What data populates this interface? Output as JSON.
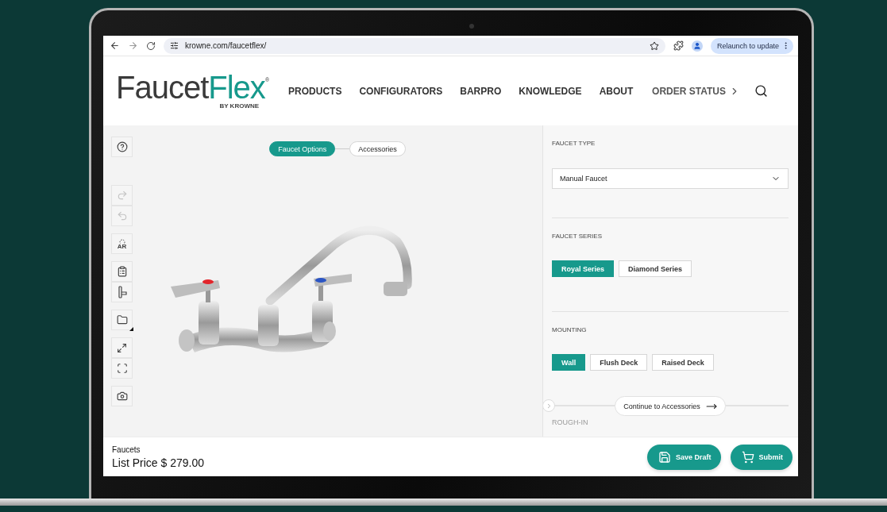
{
  "browser": {
    "url": "krowne.com/faucetflex/",
    "relaunch_label": "Relaunch to update"
  },
  "site": {
    "logo": {
      "main": "Faucet",
      "accent": "Flex",
      "mark": "®",
      "byline": "BY KROWNE"
    },
    "nav": [
      "PRODUCTS",
      "CONFIGURATORS",
      "BARPRO",
      "KNOWLEDGE",
      "ABOUT"
    ],
    "order_status": "ORDER STATUS"
  },
  "viewer": {
    "steps": [
      {
        "label": "Faucet Options",
        "selected": true
      },
      {
        "label": "Accessories",
        "selected": false
      }
    ],
    "tool_groups": [
      [
        {
          "kind": "help",
          "disabled": false
        }
      ],
      [
        {
          "kind": "redo",
          "disabled": true
        },
        {
          "kind": "undo",
          "disabled": true
        }
      ],
      [
        {
          "kind": "ar",
          "label": "AR",
          "disabled": false
        }
      ],
      [
        {
          "kind": "clipboard",
          "disabled": false
        },
        {
          "kind": "handle",
          "disabled": false
        }
      ],
      [
        {
          "kind": "folder",
          "disabled": false
        }
      ],
      [
        {
          "kind": "expand",
          "disabled": false
        },
        {
          "kind": "frame",
          "disabled": false
        }
      ],
      [
        {
          "kind": "camera",
          "disabled": false
        }
      ]
    ]
  },
  "panel": {
    "sections": [
      {
        "kind": "select",
        "title": "FAUCET TYPE",
        "value": "Manual Faucet"
      },
      {
        "kind": "options",
        "title": "FAUCET SERIES",
        "options": [
          {
            "label": "Royal Series",
            "selected": true
          },
          {
            "label": "Diamond Series",
            "selected": false
          }
        ]
      },
      {
        "kind": "options",
        "title": "MOUNTING",
        "options": [
          {
            "label": "Wall",
            "selected": true
          },
          {
            "label": "Flush Deck",
            "selected": false
          },
          {
            "label": "Raised Deck",
            "selected": false
          }
        ]
      }
    ],
    "continue_label": "Continue to Accessories",
    "next_title": "ROUGH-IN"
  },
  "footer": {
    "category": "Faucets",
    "price": "List Price $ 279.00",
    "buttons": [
      {
        "kind": "save",
        "label": "Save Draft"
      },
      {
        "kind": "cart",
        "label": "Submit"
      }
    ]
  }
}
